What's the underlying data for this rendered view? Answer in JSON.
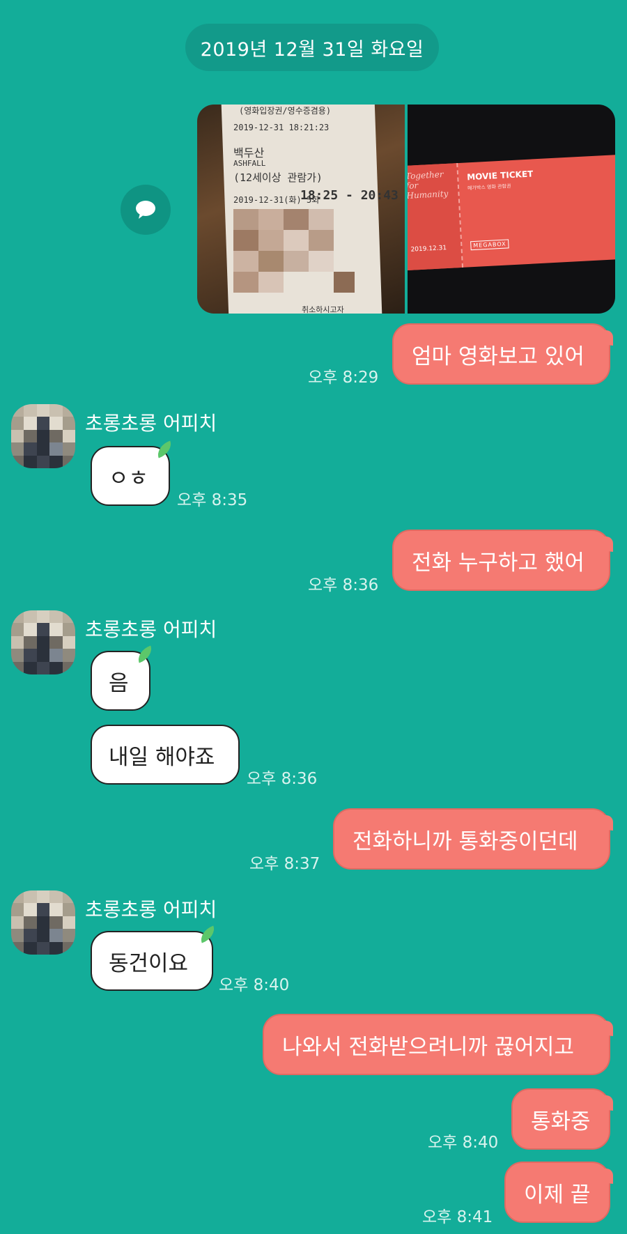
{
  "date_divider": "2019년 12월 31일 화요일",
  "receipt": {
    "line1": "(영화입장권/영수증겸용)",
    "line2": "2019-12-31 18:21:23",
    "title_kr": "백두산",
    "title_en": "ASHFALL",
    "rating": "(12세이상 관람가)",
    "showtime_date": "2019-12-31(화) 5회",
    "showtime": "18:25 - 20:43",
    "footer": "취소하시고자"
  },
  "ticket": {
    "heading": "MOVIE TICKET",
    "sub": "메가박스 영화 관람권",
    "slogan": "Together for Humanity",
    "date": "2019.12.31",
    "brand": "MEGABOX"
  },
  "contact_name": "초롱초롱 어피치",
  "messages": [
    {
      "from": "me",
      "text": "엄마 영화보고 있어",
      "time": "오후 8:29"
    },
    {
      "from": "them",
      "text": "ㅇㅎ",
      "time": "오후 8:35"
    },
    {
      "from": "me",
      "text": "전화 누구하고 했어",
      "time": "오후 8:36"
    },
    {
      "from": "them",
      "text": "음",
      "time": ""
    },
    {
      "from": "them",
      "text": "내일 해야죠",
      "time": "오후 8:36"
    },
    {
      "from": "me",
      "text": "전화하니까 통화중이던데",
      "time": "오후 8:37"
    },
    {
      "from": "them",
      "text": "동건이요",
      "time": "오후 8:40"
    },
    {
      "from": "me",
      "text": "나와서 전화받으려니까 끊어지고",
      "time": ""
    },
    {
      "from": "me",
      "text": "통화중",
      "time": "오후 8:40"
    },
    {
      "from": "me",
      "text": "이제 끝",
      "time": "오후 8:41"
    }
  ],
  "icons": {
    "share": "speech-bubble-icon",
    "leaf": "leaf-icon"
  },
  "colors": {
    "background": "#13ad99",
    "my_bubble": "#f57a72",
    "their_bubble": "#ffffff"
  }
}
